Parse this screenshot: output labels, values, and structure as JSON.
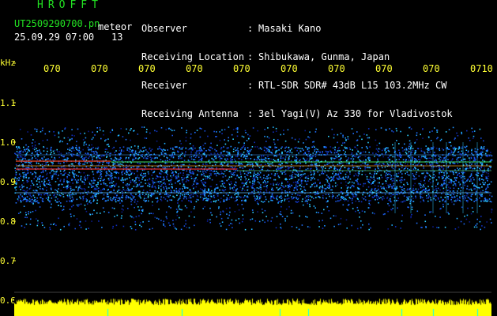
{
  "header": {
    "brand": "HROFFT",
    "filename": "UT2509290700.pn",
    "meteor_label": "meteor",
    "datetime": "25.09.29 07:00",
    "count": "13",
    "info": [
      {
        "label": "Observer",
        "value": "Masaki Kano"
      },
      {
        "label": "Receiving Location",
        "value": "Shibukawa, Gunma, Japan"
      },
      {
        "label": "Receiver",
        "value": "RTL-SDR SDR# 43dB L15 103.2MHz CW"
      },
      {
        "label": "Receiving Antenna",
        "value": "3el Yagi(V) Az 330 for Vladivostok"
      }
    ]
  },
  "axis": {
    "unit": "kHz",
    "time_ticks": [
      "070",
      "070",
      "070",
      "070",
      "070",
      "070",
      "070",
      "070",
      "070",
      "0710"
    ],
    "freq_ticks": [
      "1.1",
      "1.0",
      "0.9",
      "0.8",
      "0.7",
      "0.6"
    ]
  },
  "colors": {
    "text_green": "#22e222",
    "text_yellow": "#ffff33",
    "text_white": "#ffffff",
    "background": "#000000",
    "footer_yellow": "#ffff00",
    "footer_cyan": "#00ffff"
  }
}
